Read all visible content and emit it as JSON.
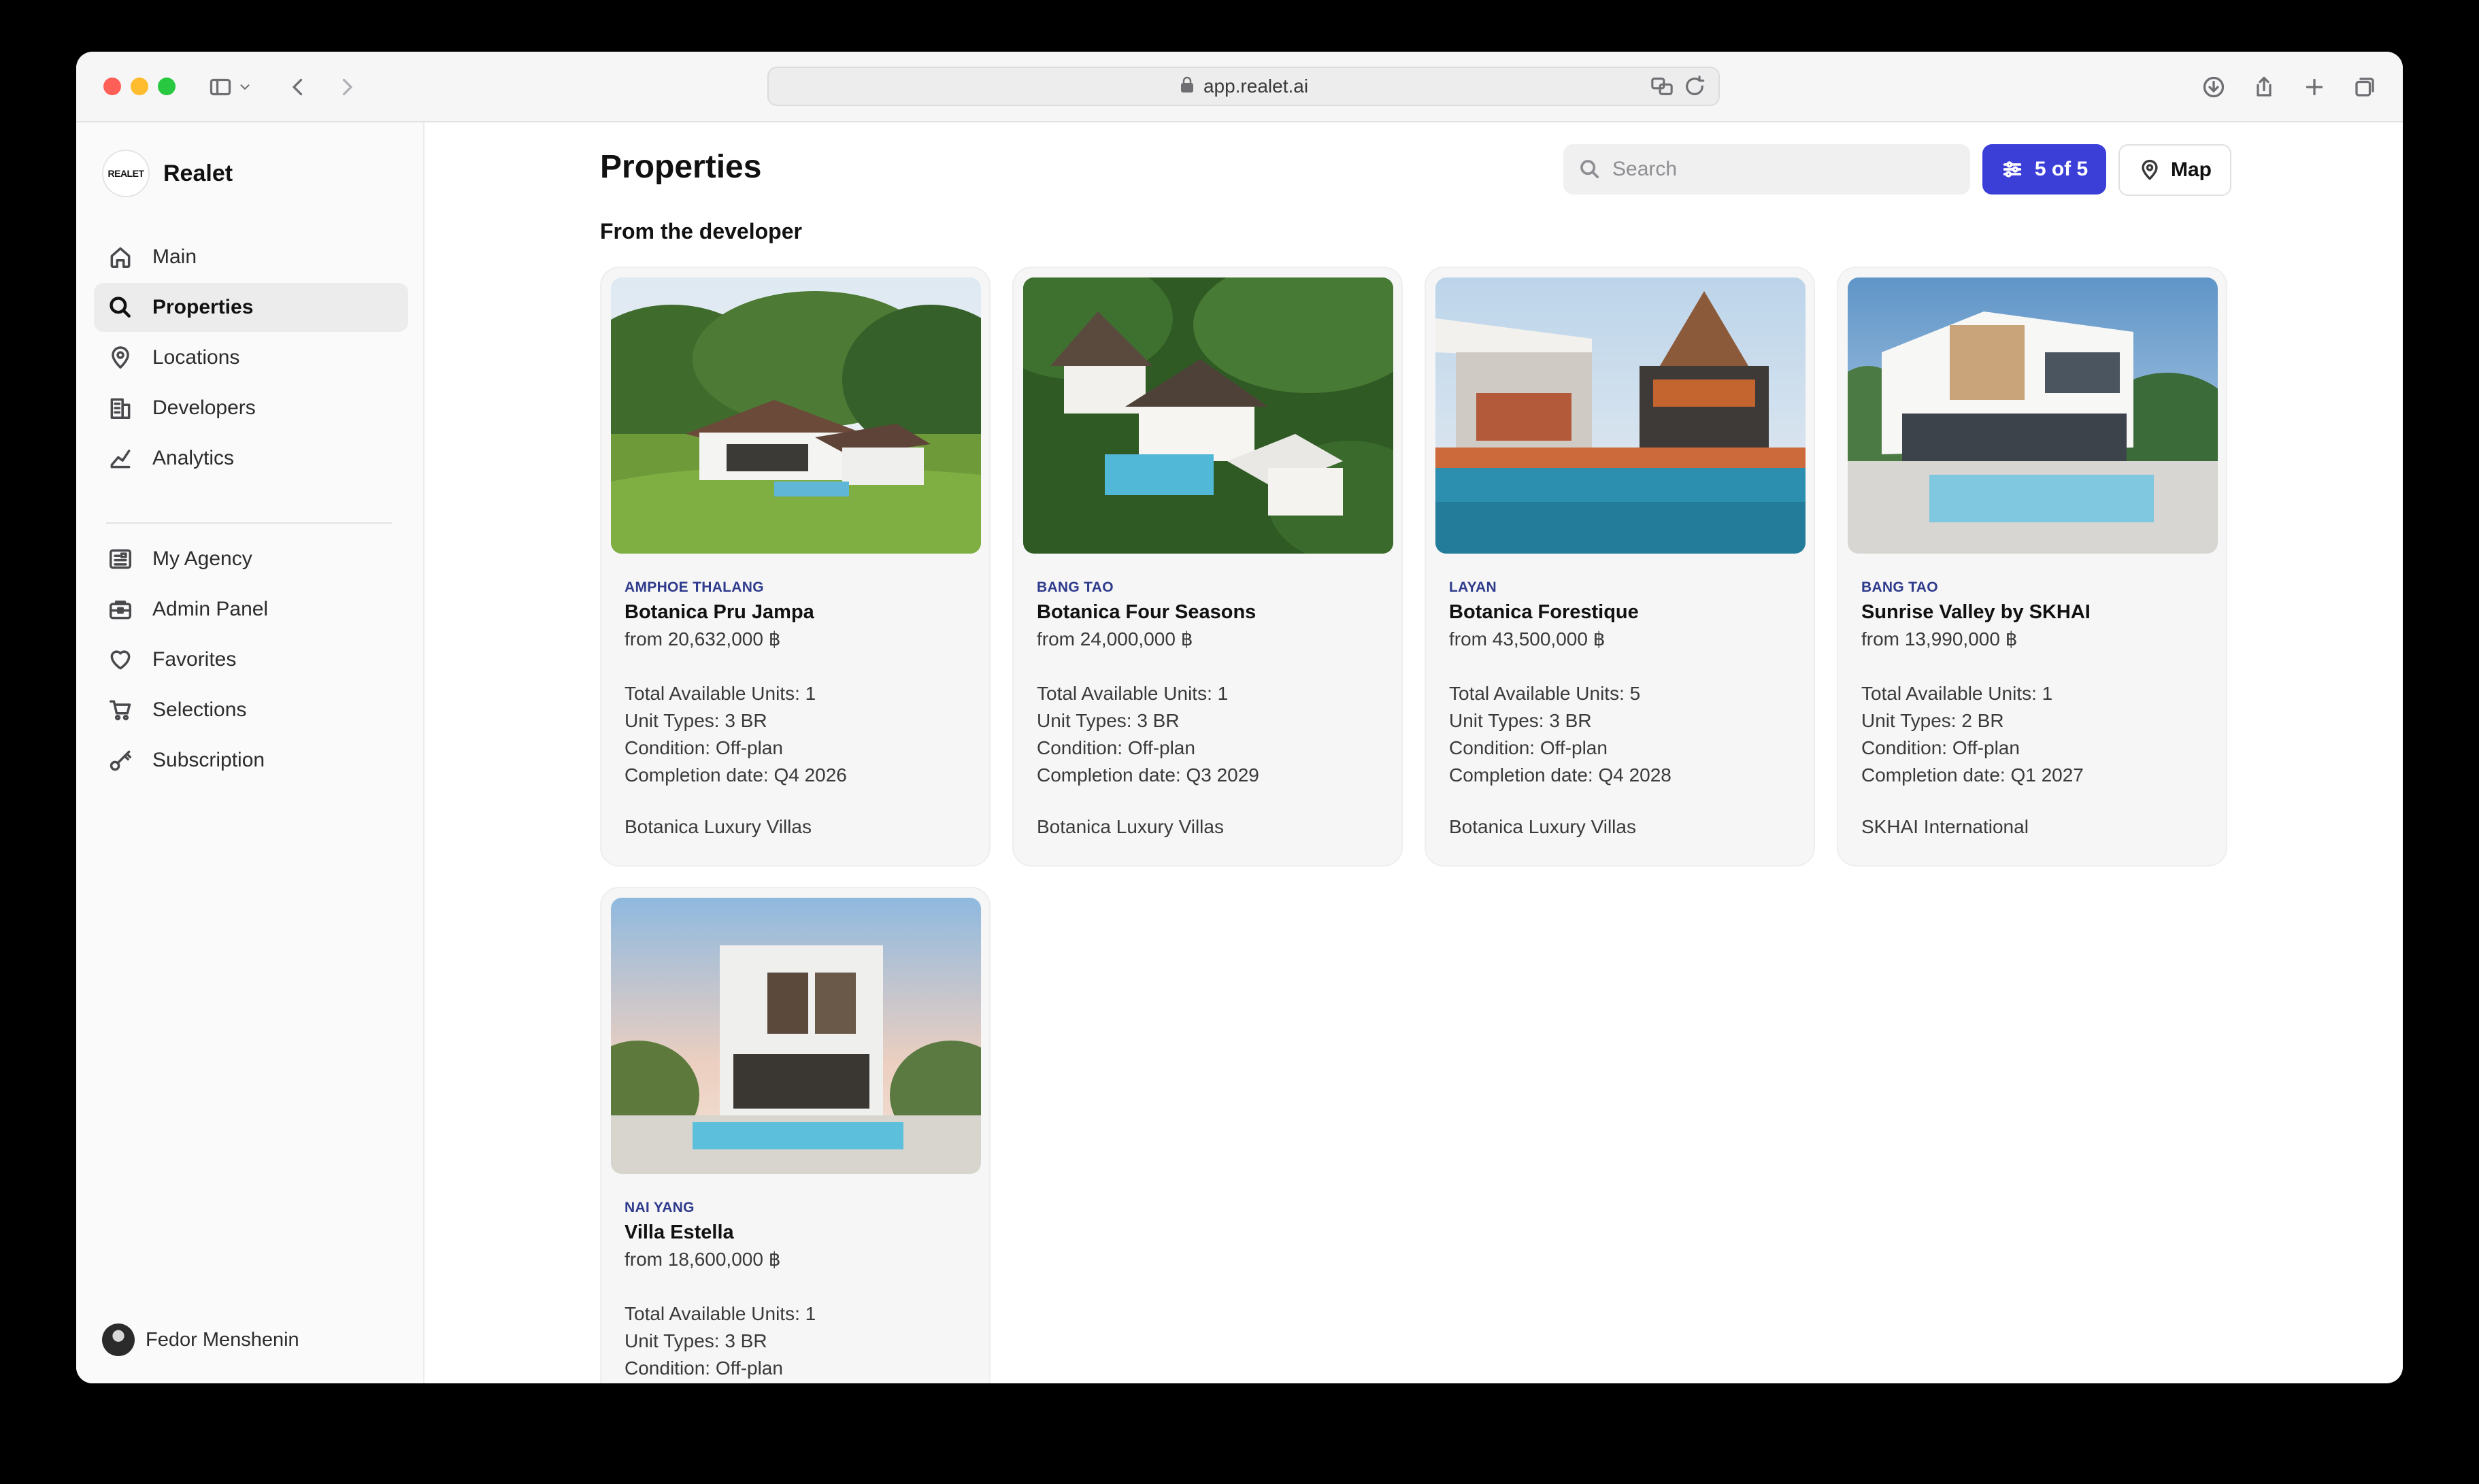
{
  "browser": {
    "url": "app.realet.ai"
  },
  "sidebar": {
    "brand_logo_text": "REALET",
    "brand_name": "Realet",
    "items": [
      {
        "label": "Main",
        "icon": "home-icon"
      },
      {
        "label": "Properties",
        "icon": "search-icon",
        "active": true
      },
      {
        "label": "Locations",
        "icon": "location-pin-icon"
      },
      {
        "label": "Developers",
        "icon": "building-icon"
      },
      {
        "label": "Analytics",
        "icon": "chart-line-icon"
      }
    ],
    "items_secondary": [
      {
        "label": "My Agency",
        "icon": "agency-icon"
      },
      {
        "label": "Admin Panel",
        "icon": "briefcase-icon"
      },
      {
        "label": "Favorites",
        "icon": "heart-icon"
      },
      {
        "label": "Selections",
        "icon": "cart-icon"
      },
      {
        "label": "Subscription",
        "icon": "key-icon"
      }
    ],
    "user_name": "Fedor Menshenin"
  },
  "main": {
    "title": "Properties",
    "search_placeholder": "Search",
    "filter_label": "5 of 5",
    "map_label": "Map",
    "section_title": "From the developer",
    "accent_color": "#3b3fd8",
    "properties": [
      {
        "location": "AMPHOE THALANG",
        "name": "Botanica Pru Jampa",
        "price": "from 20,632,000 ฿",
        "units": "Total Available Units: 1",
        "unit_types": "Unit Types: 3 BR",
        "condition": "Condition: Off-plan",
        "completion": "Completion date: Q4 2026",
        "developer": "Botanica Luxury Villas"
      },
      {
        "location": "BANG TAO",
        "name": "Botanica Four Seasons",
        "price": "from 24,000,000 ฿",
        "units": "Total Available Units: 1",
        "unit_types": "Unit Types: 3 BR",
        "condition": "Condition: Off-plan",
        "completion": "Completion date: Q3 2029",
        "developer": "Botanica Luxury Villas"
      },
      {
        "location": "LAYAN",
        "name": "Botanica Forestique",
        "price": "from 43,500,000 ฿",
        "units": "Total Available Units: 5",
        "unit_types": "Unit Types: 3 BR",
        "condition": "Condition: Off-plan",
        "completion": "Completion date: Q4 2028",
        "developer": "Botanica Luxury Villas"
      },
      {
        "location": "BANG TAO",
        "name": "Sunrise Valley by SKHAI",
        "price": "from 13,990,000 ฿",
        "units": "Total Available Units: 1",
        "unit_types": "Unit Types: 2 BR",
        "condition": "Condition: Off-plan",
        "completion": "Completion date: Q1 2027",
        "developer": "SKHAI International"
      },
      {
        "location": "NAI YANG",
        "name": "Villa Estella",
        "price": "from 18,600,000 ฿",
        "units": "Total Available Units: 1",
        "unit_types": "Unit Types: 3 BR",
        "condition": "Condition: Off-plan",
        "completion": "",
        "developer": ""
      }
    ]
  }
}
